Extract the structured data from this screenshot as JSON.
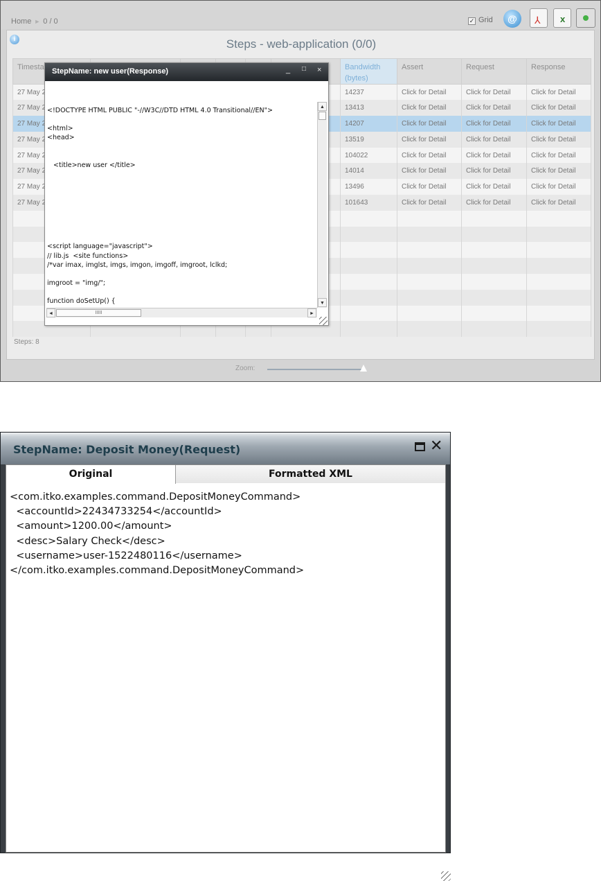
{
  "top_window": {
    "breadcrumb": {
      "home": "Home",
      "sep": "►",
      "position": "0 / 0"
    },
    "grid_toggle": {
      "label": "Grid",
      "checked": true,
      "mark": "✓"
    },
    "toolbar_icons": [
      "email-icon",
      "pdf-export-icon",
      "excel-export-icon",
      "database-icon"
    ],
    "page_title": "Steps - web-application (0/0)",
    "table": {
      "headers": [
        "Timesta",
        "",
        "",
        "",
        "",
        "",
        "Bandwidth (bytes)",
        "Assert",
        "Request",
        "Response"
      ],
      "bandwidth_header": [
        "Bandwidth",
        "(bytes)"
      ],
      "rows": [
        {
          "timestamp": "27 May 2",
          "bandwidth": "14237",
          "assert": "Click for Detail",
          "request": "Click for Detail",
          "response": "Click for Detail"
        },
        {
          "timestamp": "27 May 2",
          "bandwidth": "13413",
          "assert": "Click for Detail",
          "request": "Click for Detail",
          "response": "Click for Detail"
        },
        {
          "timestamp": "27 May 2",
          "bandwidth": "14207",
          "assert": "Click for Detail",
          "request": "Click for Detail",
          "response": "Click for Detail"
        },
        {
          "timestamp": "27 May 2",
          "bandwidth": "13519",
          "assert": "Click for Detail",
          "request": "Click for Detail",
          "response": "Click for Detail"
        },
        {
          "timestamp": "27 May 2",
          "bandwidth": "104022",
          "assert": "Click for Detail",
          "request": "Click for Detail",
          "response": "Click for Detail"
        },
        {
          "timestamp": "27 May 2",
          "bandwidth": "14014",
          "assert": "Click for Detail",
          "request": "Click for Detail",
          "response": "Click for Detail"
        },
        {
          "timestamp": "27 May 2",
          "bandwidth": "13496",
          "assert": "Click for Detail",
          "request": "Click for Detail",
          "response": "Click for Detail"
        },
        {
          "timestamp": "27 May 2",
          "bandwidth": "101643",
          "assert": "Click for Detail",
          "request": "Click for Detail",
          "response": "Click for Detail"
        }
      ],
      "selected_row": 2,
      "empty_rows": 8
    },
    "steps_count": "Steps: 8",
    "zoom_label": "Zoom:",
    "colors": {
      "selected_row": "#b7d6ee",
      "title_text": "#6b7b88",
      "bandwidth_header": "#7fb0d8"
    }
  },
  "response_dialog": {
    "title": "StepName: new user(Response)",
    "controls": {
      "minimize": "_",
      "maximize": "□",
      "close": "×"
    },
    "code": "<!DOCTYPE HTML PUBLIC \"-//W3C//DTD HTML 4.0 Transitional//EN\">\n\n<html>\n<head>\n\n\n   <title>new user </title>\n\n\n\n\n\n\n\n\n<script language=\"javascript\">\n// lib.js  <site functions>\n/*var imax, imglst, imgs, imgon, imgoff, imgroot, lclkd;\n\nimgroot = \"img/\";\n\nfunction doSetUp() {",
    "scroll": {
      "up": "▲",
      "down": "▼",
      "left": "◄",
      "right": "►",
      "thumb_grip": "IIIII"
    }
  },
  "request_dialog": {
    "title": "StepName: Deposit Money(Request)",
    "controls": {
      "maximize": "□",
      "close": "✕"
    },
    "tabs": [
      {
        "label": "Original",
        "active": true
      },
      {
        "label": "Formatted XML",
        "active": false
      }
    ],
    "code": "<com.itko.examples.command.DepositMoneyCommand>\n  <accountId>22434733254</accountId>\n  <amount>1200.00</amount>\n  <desc>Salary Check</desc>\n  <username>user-1522480116</username>\n</com.itko.examples.command.DepositMoneyCommand>"
  }
}
